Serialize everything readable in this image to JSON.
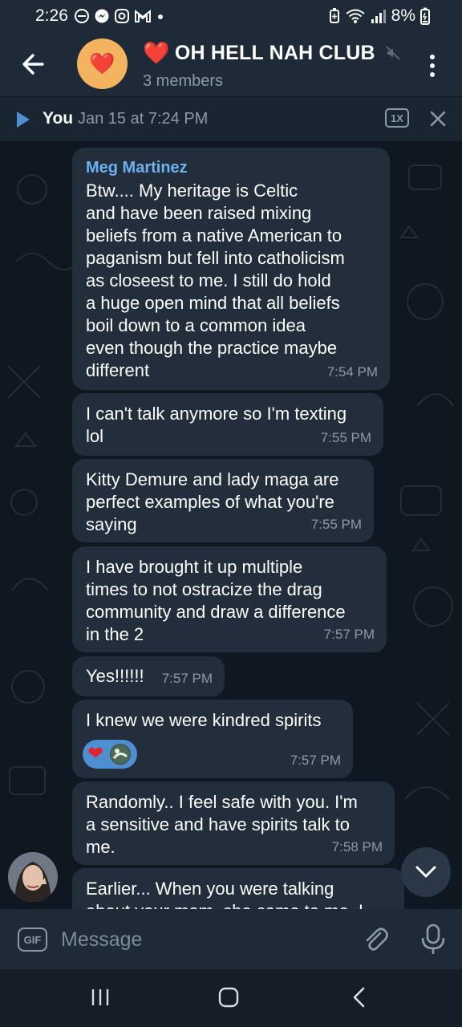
{
  "status_bar": {
    "time": "2:26",
    "battery": "8%",
    "notification_icons": [
      "do-not-disturb-icon",
      "messenger-icon",
      "instagram-icon",
      "gmail-icon",
      "dot-icon"
    ],
    "system_icons": [
      "battery-saver-icon",
      "wifi-icon",
      "signal-icon",
      "battery-icon"
    ]
  },
  "header": {
    "avatar_emoji": "❤️",
    "title_emoji": "❤️",
    "title": "OH HELL NAH CLUB",
    "subtitle": "3 members",
    "muted": true
  },
  "player": {
    "who": "You",
    "when": "Jan 15 at 7:24 PM",
    "speed": "1X"
  },
  "messages": [
    {
      "sender": "Meg Martinez",
      "text": "Btw.... My heritage is Celtic\nand have been raised mixing\nbeliefs from a native American to\npaganism but fell into catholicism\nas closeest to me. I still do hold\na huge open mind that all beliefs\nboil down to a common idea\neven though the practice maybe\ndifferent",
      "time": "7:54 PM"
    },
    {
      "text": "I can't talk anymore so I'm texting\nlol",
      "time": "7:55 PM"
    },
    {
      "text": "Kitty Demure and lady maga are\nperfect examples of what you're\nsaying",
      "time": "7:55 PM"
    },
    {
      "text": "I have brought it up multiple\ntimes to not ostracize the drag\ncommunity and draw a difference\nin the 2",
      "time": "7:57 PM"
    },
    {
      "text": "Yes!!!!!!",
      "time": "7:57 PM"
    },
    {
      "text": "I knew we were kindred spirits",
      "time": "7:57 PM",
      "reaction": "❤"
    },
    {
      "text": "Randomly.. I feel safe with you. I'm\na sensitive and have spirits talk to\nme.",
      "time": "7:58 PM"
    },
    {
      "text": "Earlier... When you were talking\nabout your mom, she came to me. I"
    }
  ],
  "input": {
    "gif_label": "GIF",
    "placeholder": "Message"
  },
  "colors": {
    "header_bg": "#1e2a38",
    "chat_bg": "#0f1720",
    "bubble_bg": "#232e3c",
    "sender_name": "#6db3f2",
    "accent": "#4e8fd1",
    "avatar_bg": "#f4b45f"
  }
}
